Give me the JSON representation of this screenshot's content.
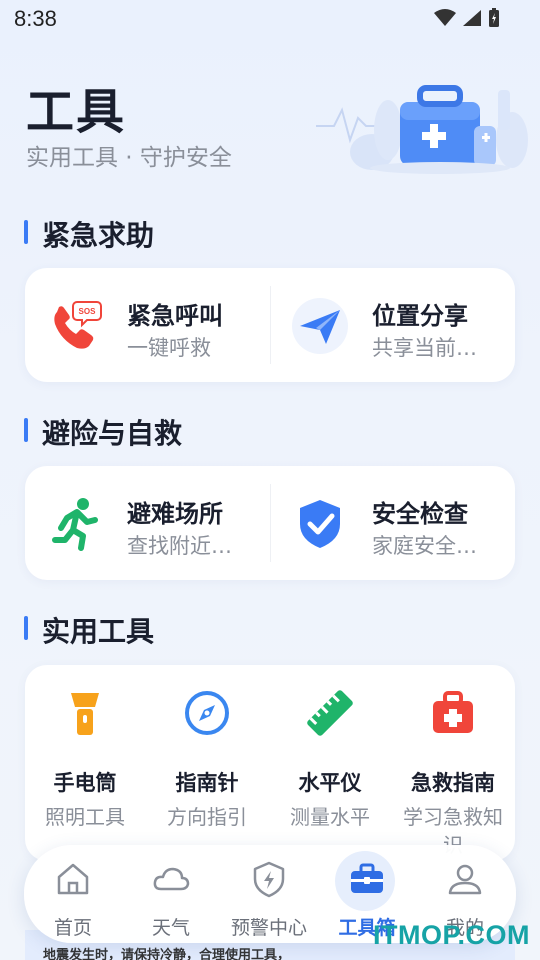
{
  "status": {
    "time": "8:38"
  },
  "header": {
    "title": "工具",
    "subtitle": "实用工具 · 守护安全"
  },
  "sections": {
    "emergency": {
      "title": "紧急求助",
      "items": [
        {
          "title": "紧急呼叫",
          "desc": "一键呼救",
          "icon": "sos-phone-icon"
        },
        {
          "title": "位置分享",
          "desc": "共享当前…",
          "icon": "paper-plane-icon"
        }
      ]
    },
    "refuge": {
      "title": "避险与自救",
      "items": [
        {
          "title": "避难场所",
          "desc": "查找附近…",
          "icon": "running-man-icon"
        },
        {
          "title": "安全检查",
          "desc": "家庭安全…",
          "icon": "shield-check-icon"
        }
      ]
    },
    "tools": {
      "title": "实用工具",
      "items": [
        {
          "title": "手电筒",
          "desc": "照明工具",
          "icon": "flashlight-icon"
        },
        {
          "title": "指南针",
          "desc": "方向指引",
          "icon": "compass-icon"
        },
        {
          "title": "水平仪",
          "desc": "测量水平",
          "icon": "ruler-icon"
        },
        {
          "title": "急救指南",
          "desc": "学习急救知识",
          "icon": "first-aid-kit-icon"
        }
      ]
    }
  },
  "banner": {
    "text": "地震发生时，请保持冷静，合理使用工具，"
  },
  "nav": {
    "items": [
      {
        "label": "首页",
        "icon": "home-icon"
      },
      {
        "label": "天气",
        "icon": "cloud-icon"
      },
      {
        "label": "预警中心",
        "icon": "alert-shield-icon"
      },
      {
        "label": "工具箱",
        "icon": "toolbox-icon",
        "active": true
      },
      {
        "label": "我的",
        "icon": "user-icon"
      }
    ]
  },
  "watermark": "ITMOP.COM",
  "colors": {
    "accent": "#2f6de4",
    "red": "#f0453a",
    "green": "#1fb46a",
    "orange": "#f7a21b"
  }
}
